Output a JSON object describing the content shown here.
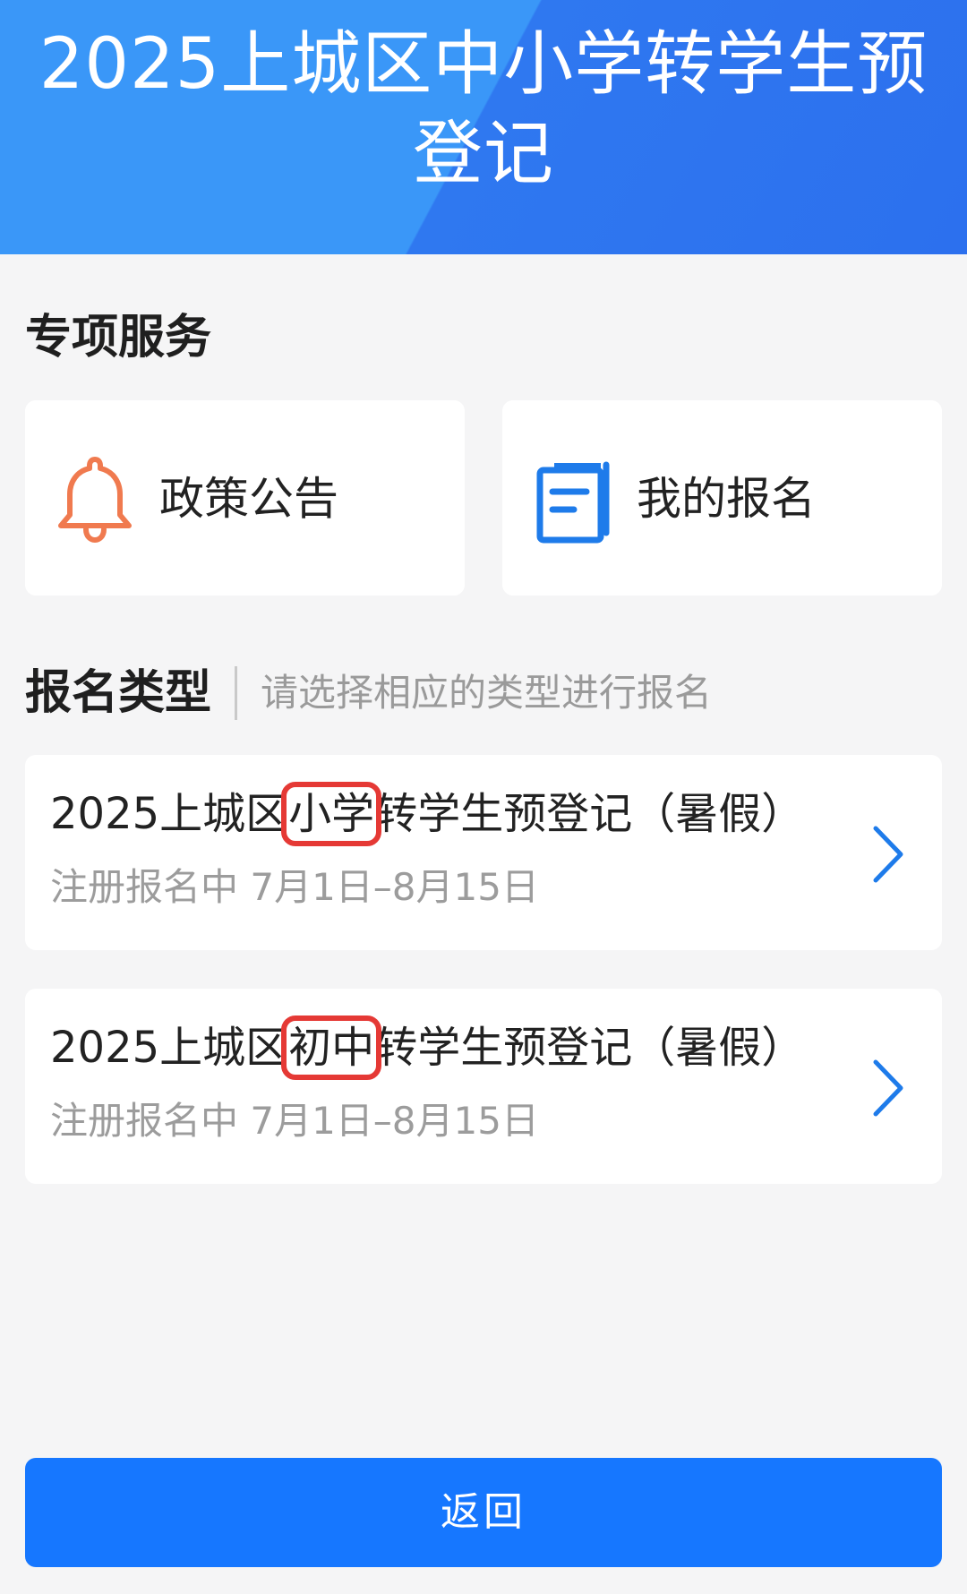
{
  "header": {
    "title": "2025上城区中小学转学生预登记"
  },
  "special_services": {
    "title": "专项服务",
    "items": [
      {
        "label": "政策公告",
        "icon": "bell-icon",
        "icon_color": "#f07a4f"
      },
      {
        "label": "我的报名",
        "icon": "document-icon",
        "icon_color": "#1e7bea"
      }
    ]
  },
  "registration_types": {
    "title": "报名类型",
    "hint": "请选择相应的类型进行报名",
    "items": [
      {
        "title_prefix": "2025上城区",
        "title_highlight": "小学",
        "title_suffix": "转学生预登记（暑假）",
        "status": "注册报名中 7月1日–8月15日"
      },
      {
        "title_prefix": "2025上城区",
        "title_highlight": "初中",
        "title_suffix": "转学生预登记（暑假）",
        "status": "注册报名中 7月1日–8月15日"
      }
    ]
  },
  "footer": {
    "back_label": "返回"
  },
  "colors": {
    "primary": "#1677ff",
    "header_light": "#3a97f8",
    "header_dark": "#2c70ee",
    "highlight_box": "#e53935"
  }
}
